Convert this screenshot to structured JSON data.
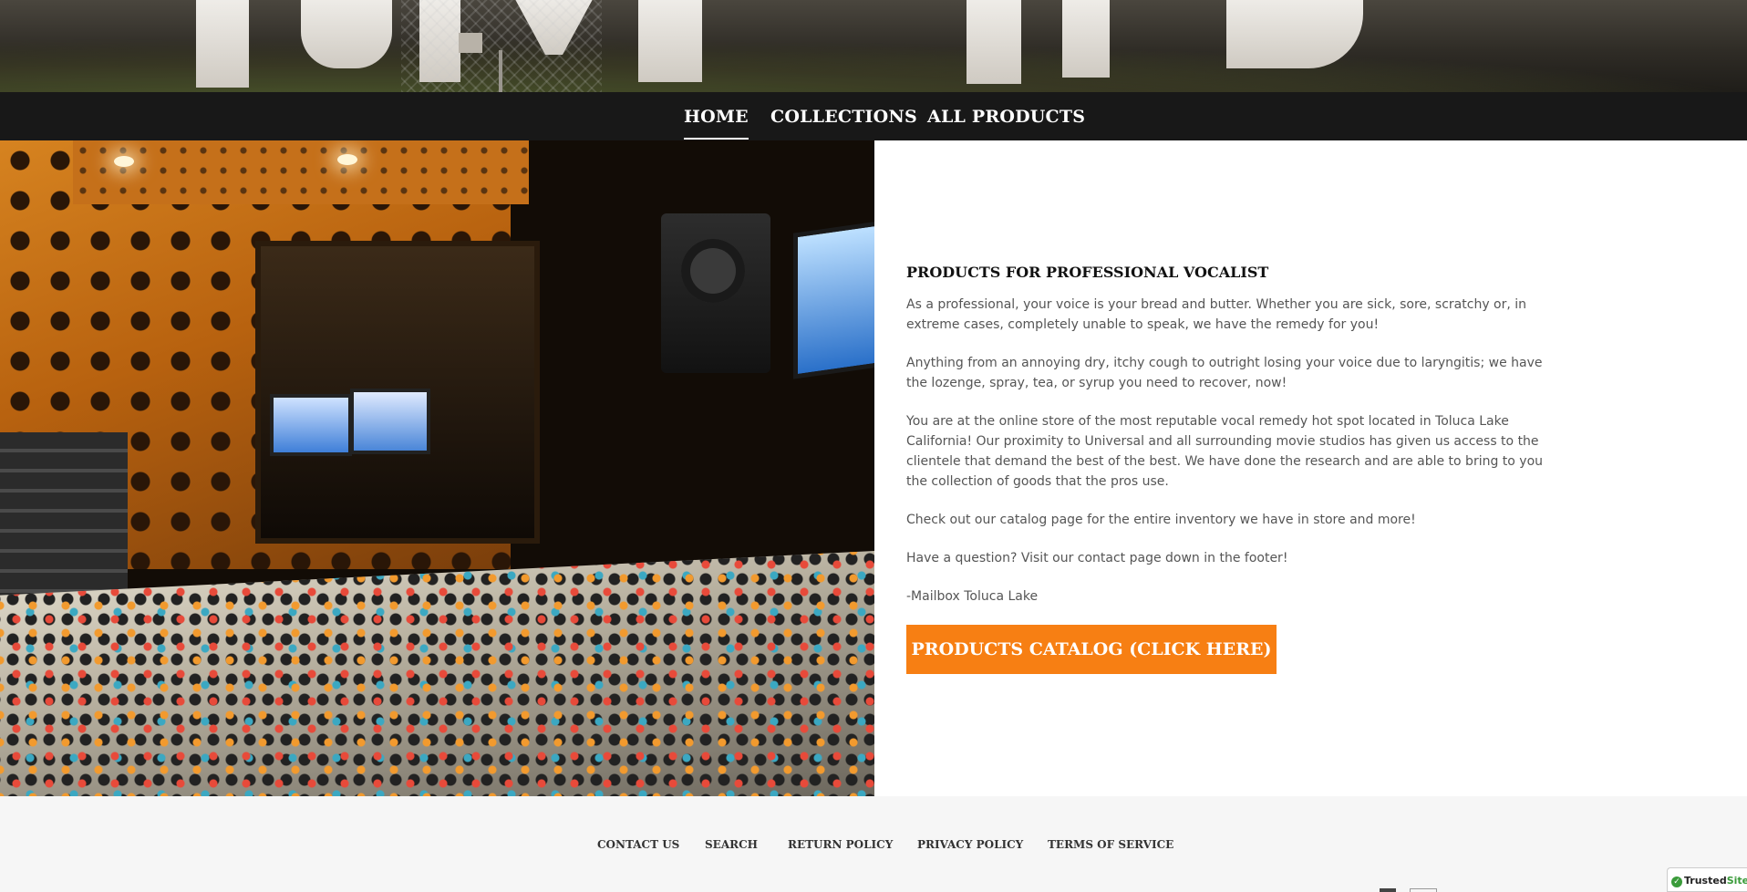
{
  "nav": {
    "items": [
      {
        "label": "HOME",
        "active": true
      },
      {
        "label": "COLLECTIONS",
        "active": false
      },
      {
        "label": "ALL PRODUCTS",
        "active": false
      }
    ]
  },
  "main": {
    "heading": "PRODUCTS FOR PROFESSIONAL VOCALIST",
    "paragraphs": [
      "As a professional, your voice is your bread and butter. Whether you are sick, sore, scratchy or, in extreme cases, completely unable to speak, we have the remedy for you!",
      "Anything from an annoying dry, itchy cough to outright losing your voice due to laryngitis; we have the lozenge, spray, tea, or syrup you need to recover, now!",
      "You are at the online store of the most reputable vocal remedy hot spot located in Toluca Lake California! Our proximity to Universal and all surrounding movie studios has given us access to the clientele that demand the best of the best. We have done the research and are able to bring to you the collection of goods that the pros use.",
      "Check out our catalog page for the entire inventory we have in store and more!",
      "Have a question? Visit our contact page down in the footer!",
      "-Mailbox Toluca Lake"
    ],
    "cta_label": "PRODUCTS CATALOG (CLICK HERE)",
    "accent_color": "#f77f13"
  },
  "footer": {
    "links": [
      "CONTACT US",
      "SEARCH",
      "RETURN POLICY",
      "PRIVACY POLICY",
      "TERMS OF SERVICE"
    ],
    "badge": {
      "text_main": "Trusted",
      "text_accent": "Site",
      "check": "✓"
    }
  }
}
